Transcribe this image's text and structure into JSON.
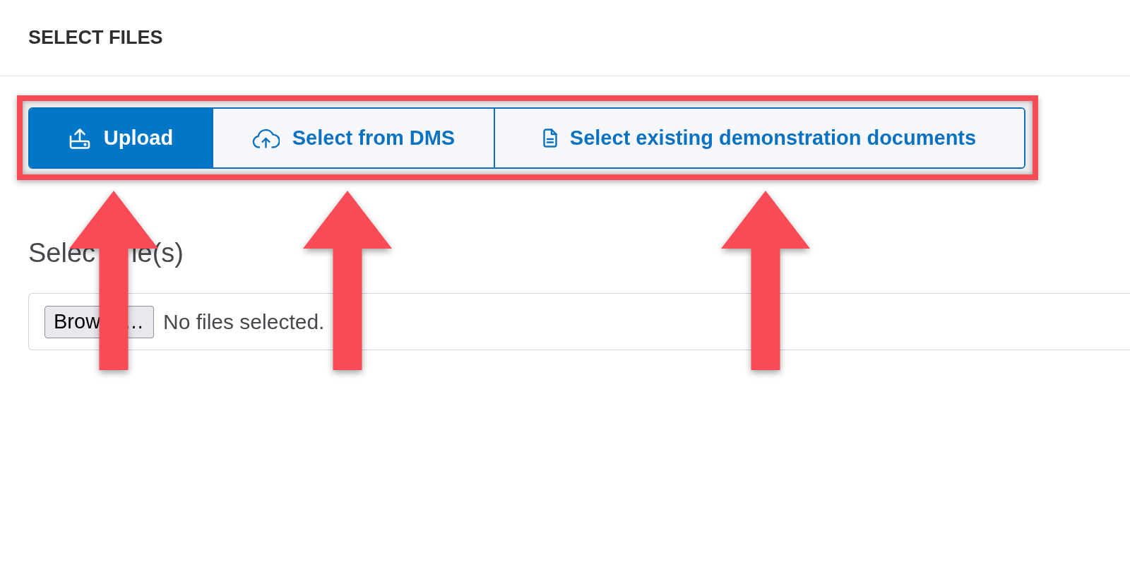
{
  "header": {
    "title": "SELECT FILES"
  },
  "source_tabs": [
    {
      "label": "Upload",
      "selected": true
    },
    {
      "label": "Select from DMS",
      "selected": false
    },
    {
      "label": "Select existing demonstration documents",
      "selected": false
    }
  ],
  "file_picker": {
    "label_parts": [
      "Selec",
      "le(s)"
    ],
    "browse_button_parts": [
      "Brow",
      "…"
    ],
    "status": "No files selected."
  }
}
